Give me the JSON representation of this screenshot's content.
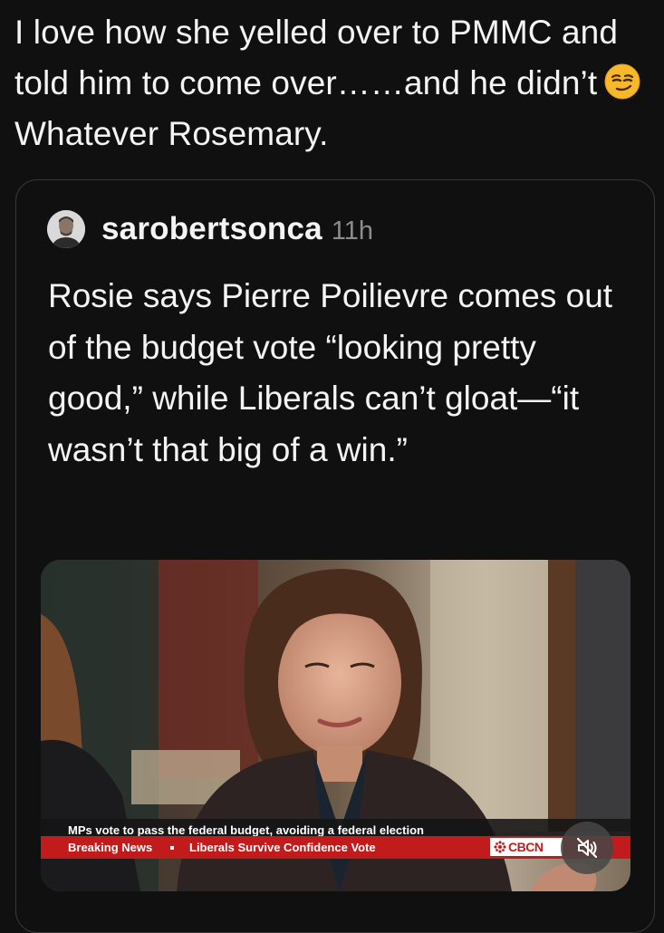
{
  "post": {
    "text_before_emoji": "I love how she yelled over to PMMC and told him to come over……and he didn’t",
    "emoji": "smirking-face-emoji",
    "text_after_emoji": "Whatever Rosemary."
  },
  "quoted_post": {
    "username": "sarobertsonca",
    "timestamp": "11h",
    "body": "Rosie says Pierre Poilievre comes out of the budget vote “looking pretty good,” while Liberals can’t gloat—“it wasn’t that big of a win.”",
    "video": {
      "headline": "MPs vote to pass the federal budget, avoiding a federal election",
      "ticker_label": "Breaking News",
      "ticker_text": "Liberals Survive Confidence Vote",
      "network": "CBCN",
      "mute_icon": "speaker-muted-icon"
    }
  },
  "colors": {
    "background": "#101010",
    "ticker_red": "#c21b1b",
    "muted_text": "#8c8c8c"
  }
}
